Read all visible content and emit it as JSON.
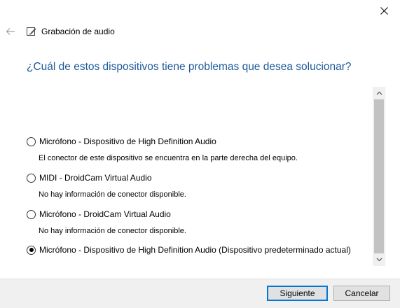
{
  "window": {
    "title": "Grabación de audio",
    "close_icon": "close-icon",
    "back_icon": "back-arrow-icon",
    "app_icon": "audio-troubleshooter-icon"
  },
  "question": "¿Cuál de estos dispositivos tiene problemas que desea solucionar?",
  "devices": [
    {
      "label": "Micrófono - Dispositivo de High Definition Audio",
      "description": "El conector de este dispositivo se encuentra en la parte derecha del equipo.",
      "selected": false
    },
    {
      "label": "MIDI - DroidCam Virtual Audio",
      "description": "No hay información de conector disponible.",
      "selected": false
    },
    {
      "label": "Micrófono - DroidCam Virtual Audio",
      "description": "No hay información de conector disponible.",
      "selected": false
    },
    {
      "label": "Micrófono - Dispositivo de High Definition Audio (Dispositivo predeterminado actual)",
      "description": "",
      "selected": true
    }
  ],
  "footer": {
    "next_label": "Siguiente",
    "cancel_label": "Cancelar"
  }
}
